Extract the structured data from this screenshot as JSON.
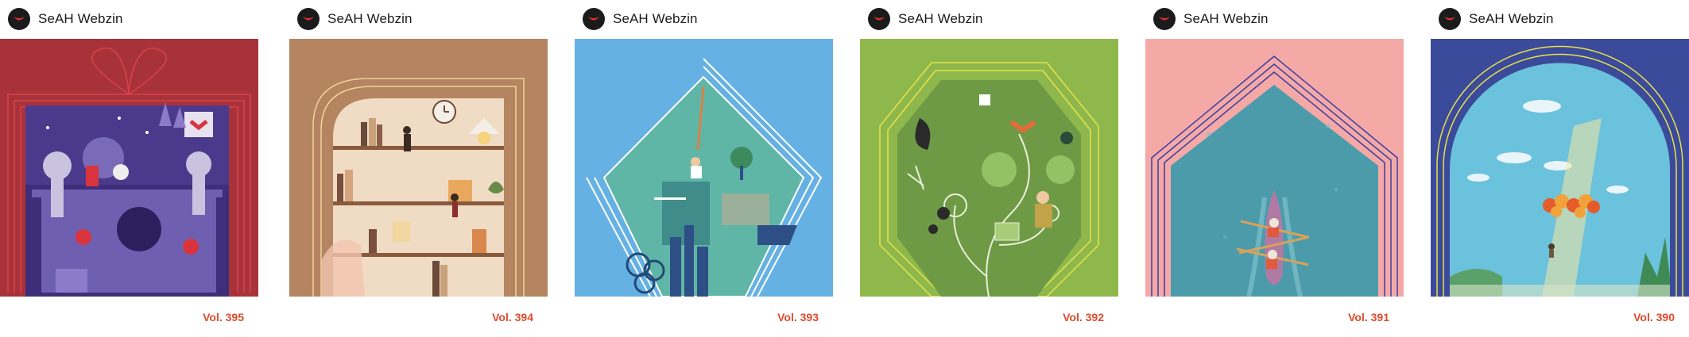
{
  "brand_colors": {
    "logo_bg": "#1b1b1b",
    "logo_mark": "#e0312b",
    "volume_text": "#e04a2b"
  },
  "cards": [
    {
      "publisher": "SeAH Webzin",
      "volume": "Vol. 395",
      "cover_bg": "#a8323a",
      "cover_theme": "holiday-gift-box"
    },
    {
      "publisher": "SeAH Webzin",
      "volume": "Vol. 394",
      "cover_bg": "#b58461",
      "cover_theme": "library-bookshelves"
    },
    {
      "publisher": "SeAH Webzin",
      "volume": "Vol. 393",
      "cover_bg": "#66b1e3",
      "cover_theme": "climbing-diamond"
    },
    {
      "publisher": "SeAH Webzin",
      "volume": "Vol. 392",
      "cover_bg": "#8fb84c",
      "cover_theme": "growth-vines"
    },
    {
      "publisher": "SeAH Webzin",
      "volume": "Vol. 391",
      "cover_bg": "#f4a9a7",
      "cover_theme": "rowing-boat"
    },
    {
      "publisher": "SeAH Webzin",
      "volume": "Vol. 390",
      "cover_bg": "#3b4a9a",
      "cover_theme": "sky-arch"
    }
  ]
}
